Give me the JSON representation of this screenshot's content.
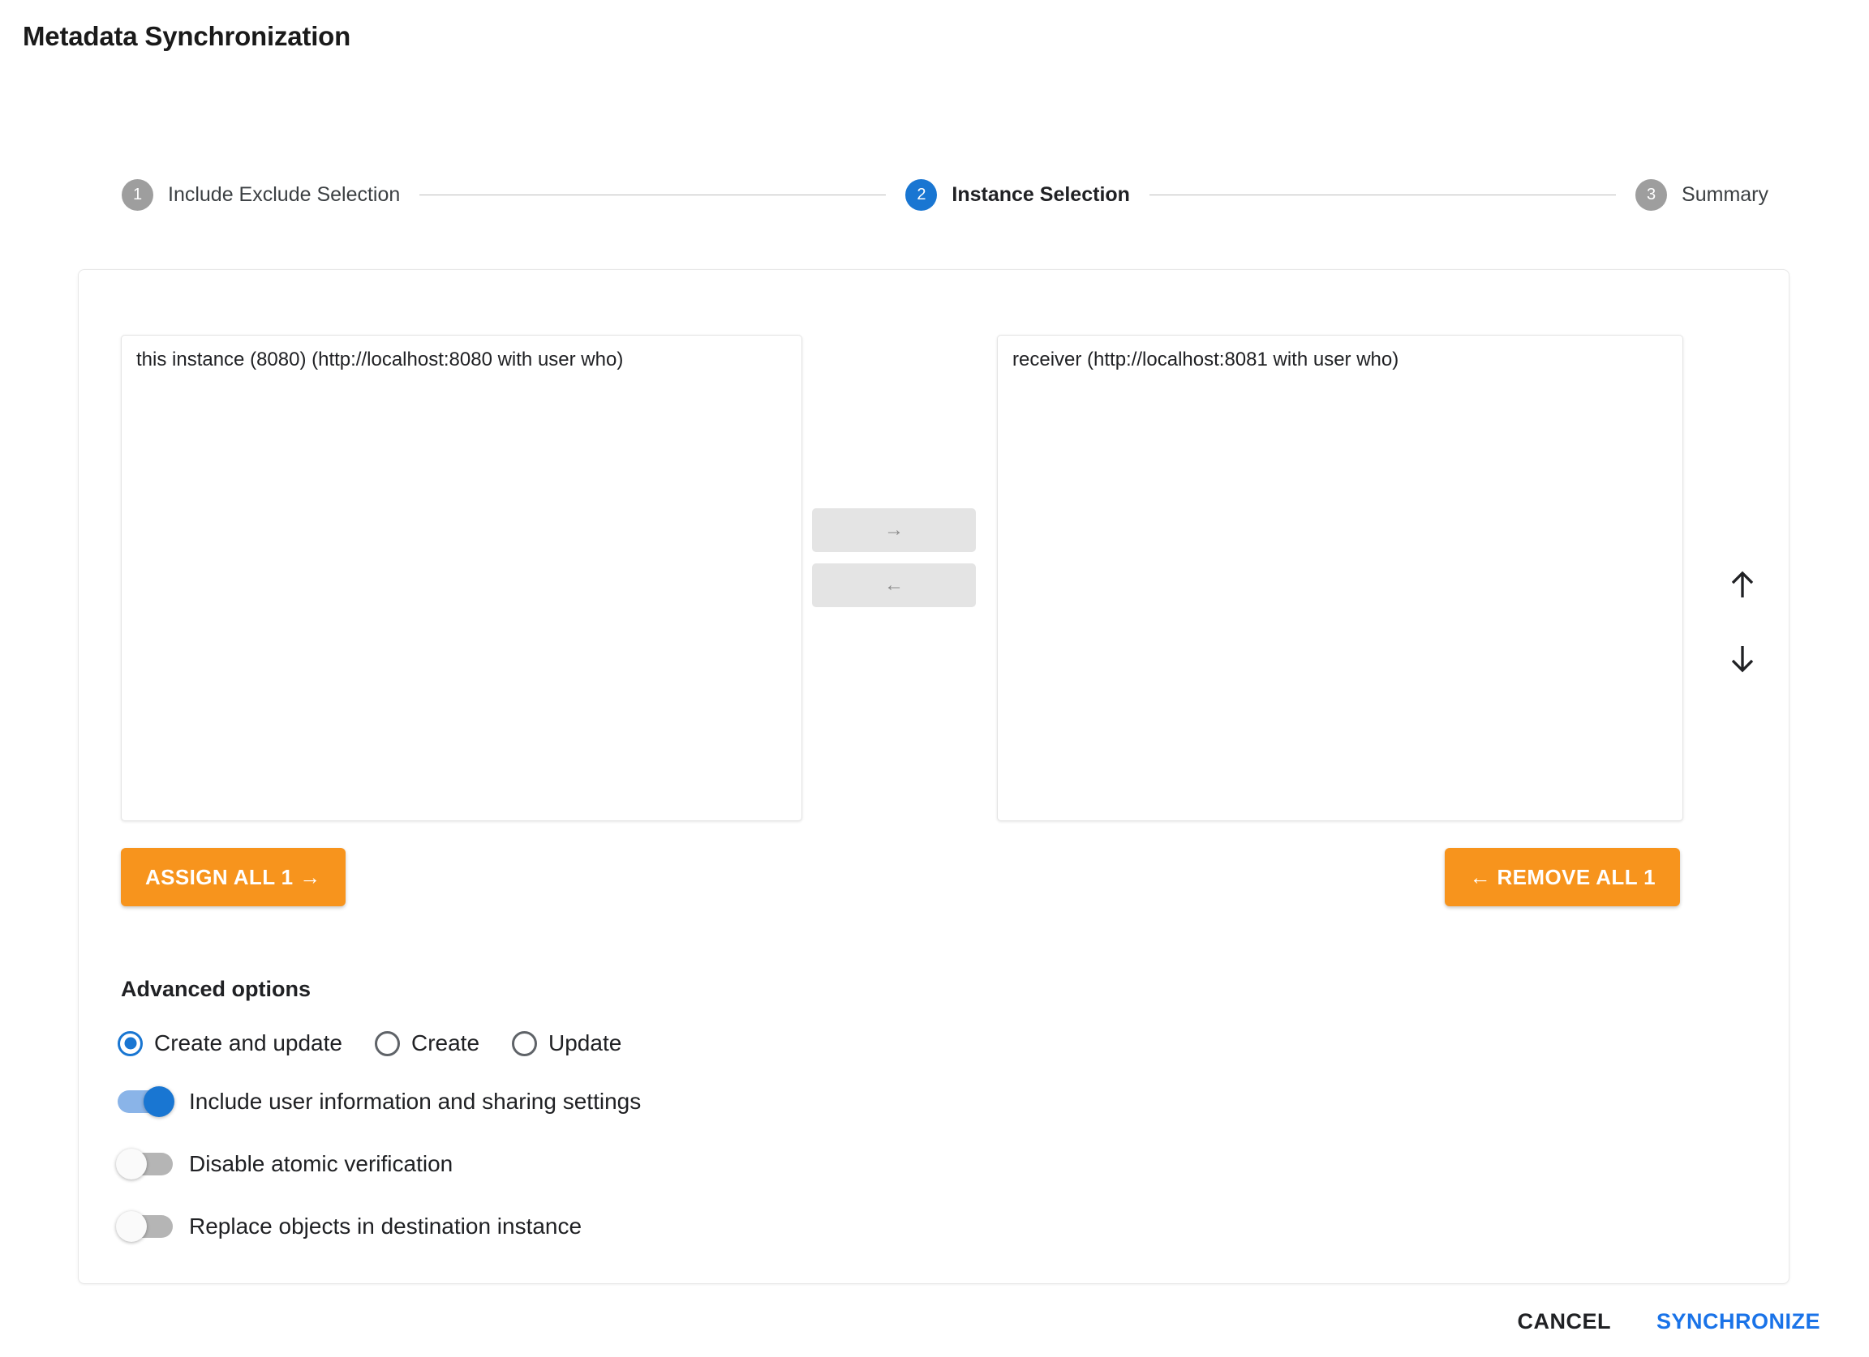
{
  "page": {
    "title": "Metadata Synchronization"
  },
  "stepper": {
    "steps": [
      {
        "number": "1",
        "label": "Include Exclude Selection",
        "active": false
      },
      {
        "number": "2",
        "label": "Instance Selection",
        "active": true
      },
      {
        "number": "3",
        "label": "Summary",
        "active": false
      }
    ]
  },
  "dual_list": {
    "source": {
      "options": [
        "this instance (8080) (http://localhost:8080 with user who)"
      ]
    },
    "target": {
      "options": [
        "receiver (http://localhost:8081 with user who)"
      ]
    },
    "transfer": {
      "assign_icon": "→",
      "remove_icon": "←"
    },
    "assign_all_label": "ASSIGN ALL 1 →",
    "remove_all_label": "← REMOVE ALL 1"
  },
  "side_arrows": {
    "up_icon": "arrow-up-icon",
    "down_icon": "arrow-down-icon"
  },
  "advanced": {
    "title": "Advanced options",
    "strategy": [
      {
        "label": "Create and update",
        "selected": true
      },
      {
        "label": "Create",
        "selected": false
      },
      {
        "label": "Update",
        "selected": false
      }
    ],
    "toggles": [
      {
        "label": "Include user information and sharing settings",
        "on": true
      },
      {
        "label": "Disable atomic verification",
        "on": false
      },
      {
        "label": "Replace objects in destination instance",
        "on": false
      }
    ]
  },
  "footer": {
    "cancel_label": "CANCEL",
    "synchronize_label": "SYNCHRONIZE"
  },
  "colors": {
    "accent_blue": "#1976d2",
    "link_blue": "#1a73e8",
    "orange": "#f7941d",
    "step_inactive": "#9e9e9e"
  }
}
